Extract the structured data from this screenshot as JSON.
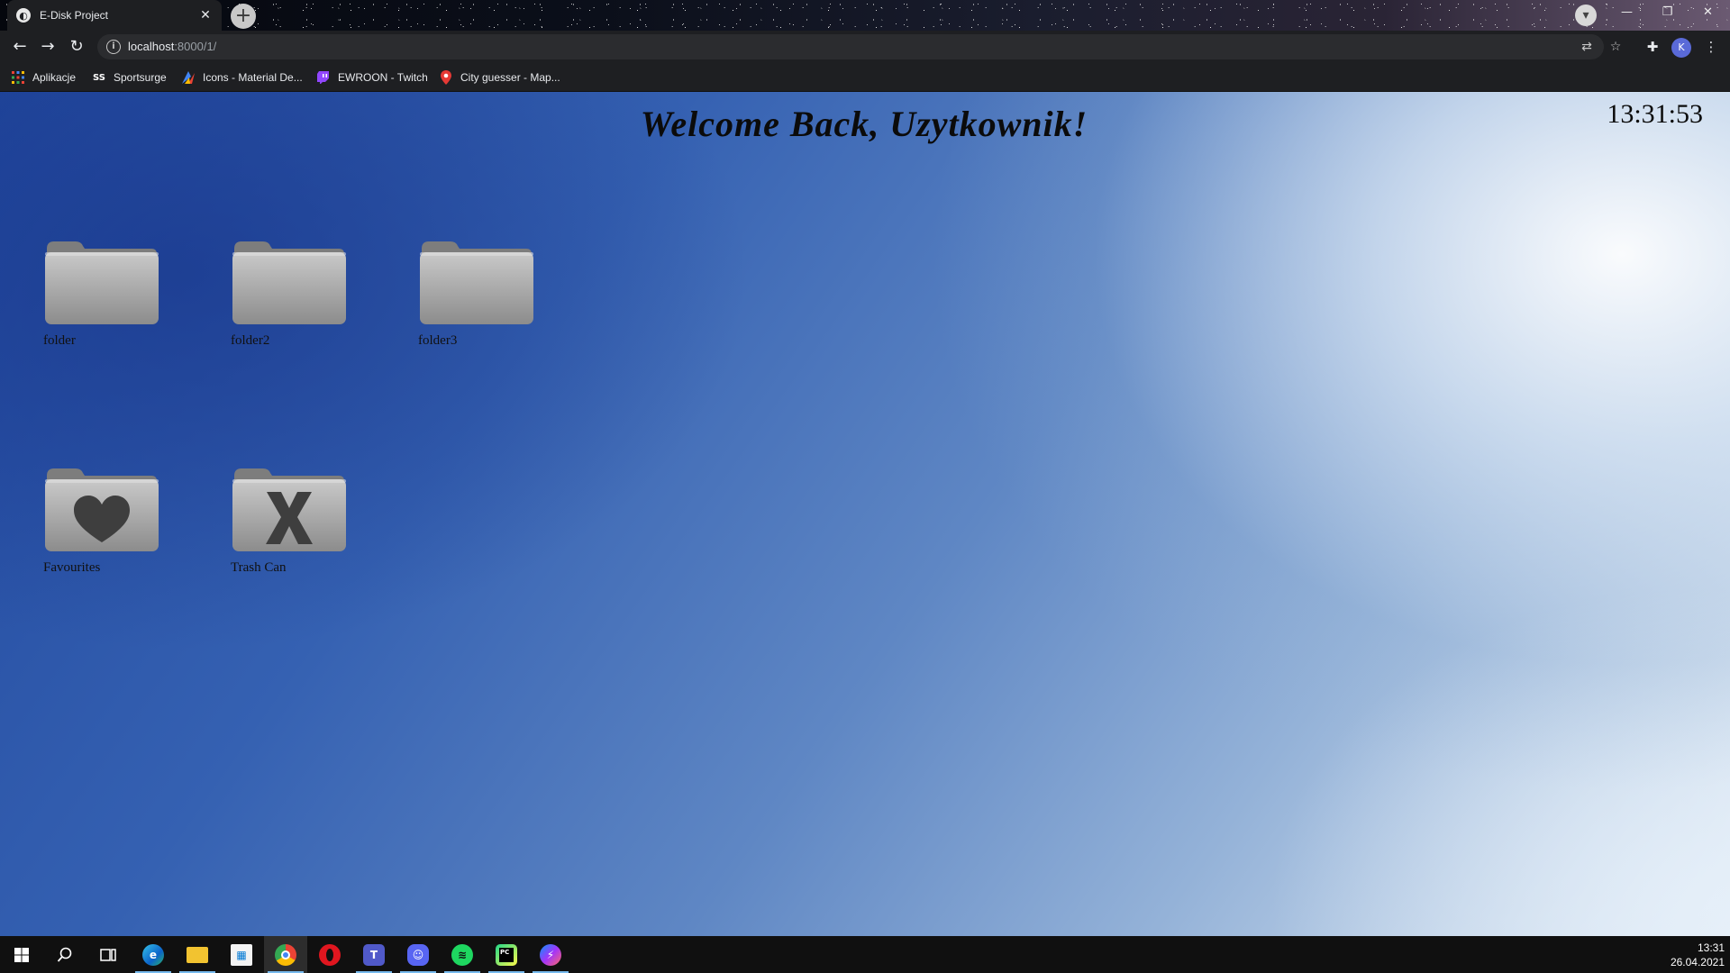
{
  "browser": {
    "tab_title": "E-Disk Project",
    "tab_close": "✕",
    "new_tab": "+",
    "url_host": "localhost",
    "url_rest": ":8000/1/",
    "profile_initial": "K"
  },
  "bookmarks": [
    {
      "label": "Aplikacje",
      "icon": "apps-grid-icon"
    },
    {
      "label": "Sportsurge",
      "icon": "ss-logo-icon"
    },
    {
      "label": "Icons - Material De...",
      "icon": "material-design-icon"
    },
    {
      "label": "EWROON - Twitch",
      "icon": "twitch-icon"
    },
    {
      "label": "City guesser - Map...",
      "icon": "map-pin-icon"
    }
  ],
  "page": {
    "welcome": "Welcome Back, Uzytkownik!",
    "clock": "13:31:53"
  },
  "folders": [
    {
      "label": "folder",
      "symbol": "none"
    },
    {
      "label": "folder2",
      "symbol": "none"
    },
    {
      "label": "folder3",
      "symbol": "none"
    },
    {
      "label": "Favourites",
      "symbol": "heart"
    },
    {
      "label": "Trash Can",
      "symbol": "x"
    }
  ],
  "taskbar": {
    "apps": [
      "start",
      "search",
      "task-view",
      "edge",
      "file-explorer",
      "store",
      "chrome",
      "opera",
      "teams",
      "discord",
      "spotify",
      "pycharm",
      "messenger"
    ],
    "time": "13:31",
    "date": "26.04.2021"
  },
  "colors": {
    "background_dark": "#21489e",
    "background_light": "#e6eef6",
    "chrome_dark": "#1e1f22",
    "folder_gray": "#a8a8a8"
  }
}
